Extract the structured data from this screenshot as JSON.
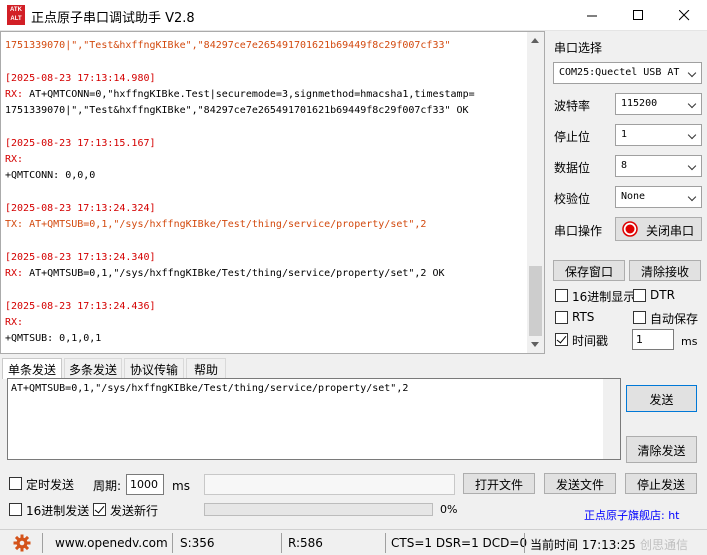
{
  "window": {
    "title": "正点原子串口调试助手 V2.8",
    "logo_text": "ATK ALIENTEK"
  },
  "receive": {
    "lines": [
      {
        "text": "1751339070|\",\"Test&hxffngKIBke\",\"84297ce7e265491701621b69449f8c29f007cf33\"",
        "color": "#d34a0f"
      },
      {
        "text": "",
        "color": "#000000"
      },
      {
        "text": "[2025-08-23 17:13:14.980]",
        "color": "#d40000"
      },
      {
        "text": "RX: AT+QMTCONN=0,\"hxffngKIBke.Test|securemode=3,signmethod=hmacsha1,timestamp=",
        "color": "#000000",
        "prefix": "RX: ",
        "prefix_color": "#d40000"
      },
      {
        "text": "1751339070|\",\"Test&hxffngKIBke\",\"84297ce7e265491701621b69449f8c29f007cf33\" OK",
        "color": "#000000"
      },
      {
        "text": "",
        "color": "#000000"
      },
      {
        "text": "[2025-08-23 17:13:15.167]",
        "color": "#d40000"
      },
      {
        "text": "RX:",
        "color": "#d40000"
      },
      {
        "text": "+QMTCONN: 0,0,0",
        "color": "#000000"
      },
      {
        "text": "",
        "color": "#000000"
      },
      {
        "text": "[2025-08-23 17:13:24.324]",
        "color": "#d40000"
      },
      {
        "text": "TX: AT+QMTSUB=0,1,\"/sys/hxffngKIBke/Test/thing/service/property/set\",2",
        "color": "#d34a0f"
      },
      {
        "text": "",
        "color": "#000000"
      },
      {
        "text": "[2025-08-23 17:13:24.340]",
        "color": "#d40000"
      },
      {
        "text": "RX: AT+QMTSUB=0,1,\"/sys/hxffngKIBke/Test/thing/service/property/set\",2 OK",
        "color": "#000000",
        "prefix": "RX: ",
        "prefix_color": "#d40000"
      },
      {
        "text": "",
        "color": "#000000"
      },
      {
        "text": "[2025-08-23 17:13:24.436]",
        "color": "#d40000"
      },
      {
        "text": "RX:",
        "color": "#d40000"
      },
      {
        "text": "+QMTSUB: 0,1,0,1",
        "color": "#000000"
      }
    ]
  },
  "serial": {
    "section_label": "串口选择",
    "port_value": "COM25:Quectel USB AT",
    "baud_label": "波特率",
    "baud_value": "115200",
    "stopbits_label": "停止位",
    "stopbits_value": "1",
    "databits_label": "数据位",
    "databits_value": "8",
    "parity_label": "校验位",
    "parity_value": "None",
    "op_label": "串口操作",
    "close_port_label": "关闭串口"
  },
  "rx_options": {
    "save_window_label": "保存窗口",
    "clear_receive_label": "清除接收",
    "hex_display_label": "16进制显示",
    "dtr_label": "DTR",
    "rts_label": "RTS",
    "auto_save_label": "自动保存",
    "timestamp_label": "时间戳",
    "timestamp_value": "1",
    "timestamp_unit": "ms",
    "hex_display_checked": false,
    "dtr_checked": false,
    "rts_checked": false,
    "auto_save_checked": false,
    "timestamp_checked": true
  },
  "tabs": [
    {
      "label": "单条发送",
      "active": true
    },
    {
      "label": "多条发送",
      "active": false
    },
    {
      "label": "协议传输",
      "active": false
    },
    {
      "label": "帮助",
      "active": false
    }
  ],
  "send": {
    "text": "AT+QMTSUB=0,1,\"/sys/hxffngKIBke/Test/thing/service/property/set\",2",
    "send_label": "发送",
    "clear_send_label": "清除发送",
    "timed_send_label": "定时发送",
    "period_label": "周期:",
    "period_value": "1000",
    "period_unit": "ms",
    "open_file_label": "打开文件",
    "send_file_label": "发送文件",
    "stop_send_label": "停止发送",
    "hex_send_label": "16进制发送",
    "newline_label": "发送新行",
    "progress_text": "0%",
    "progress": 0,
    "store_link": "正点原子旗舰店: ht",
    "timed_send_checked": false,
    "hex_send_checked": false,
    "newline_checked": true
  },
  "status": {
    "url": "www.openedv.com",
    "sent": "S:356",
    "received": "R:586",
    "lines": "CTS=1 DSR=1 DCD=0",
    "time": "当前时间 17:13:25",
    "watermark": "创思通信"
  },
  "colors": {
    "rx_red": "#d40000",
    "tx_orange": "#d34a0f",
    "link_blue": "#0000ff",
    "accent": "#0078d7"
  }
}
